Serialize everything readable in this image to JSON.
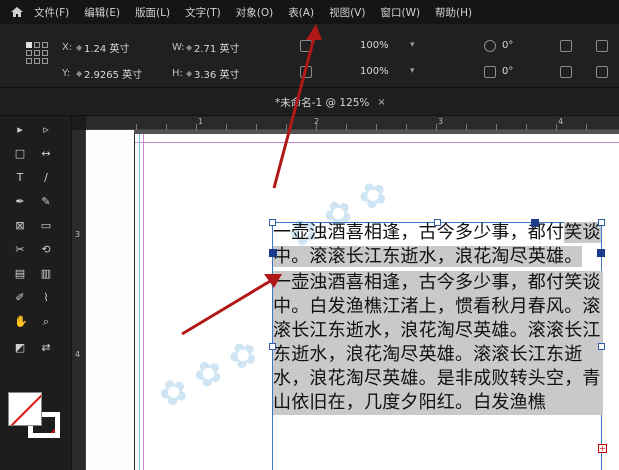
{
  "menu": {
    "items": [
      "文件(F)",
      "编辑(E)",
      "版面(L)",
      "文字(T)",
      "对象(O)",
      "表(A)",
      "视图(V)",
      "窗口(W)",
      "帮助(H)"
    ]
  },
  "control": {
    "x_label": "X:",
    "x_value": "1.24 英寸",
    "y_label": "Y:",
    "y_value": "2.9265 英寸",
    "w_label": "W:",
    "w_value": "2.71 英寸",
    "h_label": "H:",
    "h_value": "3.36 英寸",
    "scale_x": "100%",
    "scale_y": "100%",
    "rotate": "0°",
    "shear": "0°"
  },
  "tab": {
    "title": "*未命名-1 @ 125%",
    "close": "×"
  },
  "ruler": {
    "top_numbers": [
      "1",
      "2",
      "3",
      "4"
    ],
    "left_numbers": [
      "3",
      "4"
    ]
  },
  "document": {
    "para1_before": "一壶浊酒喜相逢，古今多少事，都付",
    "para1_hl": "笑谈中。滚滚长江东逝水，浪花淘尽",
    "para1_end": "英雄。",
    "para2": "一壶浊酒喜相逢，古今多少事，都付笑谈中。白发渔樵江渚上，惯看秋月春风。滚滚长江东逝水，浪花淘尽英雄。滚滚长江东逝水，浪花淘尽英雄。滚滚长江东逝水，浪花淘尽英雄。是非成败转头空，青山依旧在，几度夕阳红。白发渔樵",
    "overset": "+"
  },
  "colors": {
    "arrow": "#b01818",
    "frame": "#3f77c8",
    "highlight": "#c9c9c9"
  }
}
